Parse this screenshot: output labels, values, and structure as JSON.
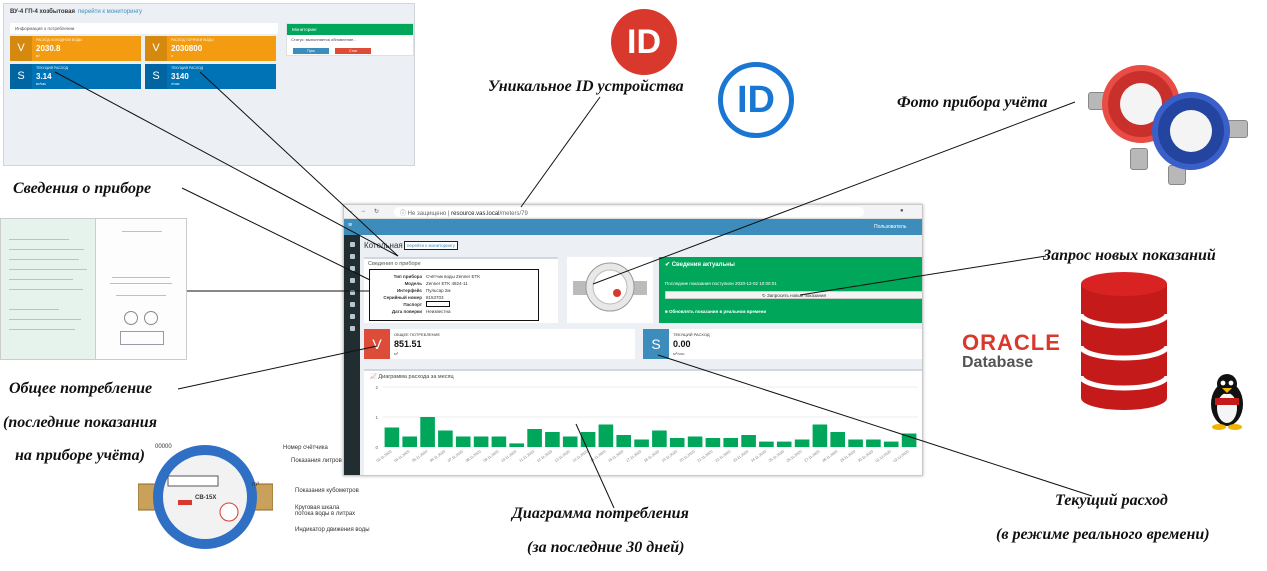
{
  "labels": {
    "unique_id": "Уникальное ID устройства",
    "photo": "Фото прибора учёта",
    "device_info": "Сведения о приборе",
    "request": "Запрос новых показаний",
    "total_line1": "Общее потребление",
    "total_line2": "(последние показания",
    "total_line3": "на приборе учёта)",
    "diagram_line1": "Диаграмма потребления",
    "diagram_line2": "(за последние 30 дней)",
    "current_line1": "Текущий расход",
    "current_line2": "(в режиме реального времени)"
  },
  "logos": {
    "id_text": "ID",
    "oracle": "ORACLE",
    "oracle_sub": "Database"
  },
  "mini": {
    "title": "ВУ-4 ГП-4 хозбытовая",
    "link": "перейти к мониторингу",
    "info_header": "Информация о потреблении",
    "status_header": "Мониторинг",
    "status_text": "Статус: выполняется обновление...",
    "btn_start": "Пуск",
    "btn_stop": "Стоп",
    "box1_label": "РАСХОД ХОЛОДНОЙ ВОДЫ",
    "box1_value": "2030.8",
    "box1_unit": "м³",
    "box2_label": "РАСХОД ГОРЯЧЕЙ ВОДЫ",
    "box2_value": "2030800",
    "box2_unit": "л",
    "box3_label": "ТЕКУЩИЙ РАСХОД",
    "box3_value": "3.14",
    "box3_unit": "м³/час",
    "box4_label": "ТЕКУЩИЙ РАСХОД",
    "box4_value": "3140",
    "box4_unit": "л/час"
  },
  "browser": {
    "not_secure": "Не защищено",
    "url_host": "resource.vas.local",
    "url_path": "/meters/79",
    "user": "Пользователь",
    "page_title": "Котельная",
    "crumb": "перейти к мониторингу",
    "info_panel_title": "Сведения о приборе",
    "fields": [
      {
        "k": "Тип прибора",
        "v": "Счётчик воды Zenner ETK"
      },
      {
        "k": "Модель",
        "v": "Zenner ETK 4824-11"
      },
      {
        "k": "Интерфейс",
        "v": "Пульсар 2м"
      },
      {
        "k": "Серийный номер",
        "v": "8153703"
      },
      {
        "k": "Паспорт",
        "v": ""
      },
      {
        "k": "Дата поверки",
        "v": "Неизвестна"
      }
    ],
    "status_title": "Сведения актуальны",
    "last_reading": "Последние показания поступили 2020-12-02 10:00:01",
    "request_btn": "Запросить новые показания",
    "realtime_check": "Обновлять показания в реальном времени",
    "total_label": "ОБЩЕЕ ПОТРЕБЛЕНИЕ",
    "total_value": "851.51",
    "total_unit": "м³",
    "total_icon": "V",
    "current_label": "ТЕКУЩИЙ РАСХОД",
    "current_value": "0.00",
    "current_unit": "м³/час",
    "current_icon": "S",
    "chart_title": "Диаграмма расхода за месяц"
  },
  "meter_annotations": [
    "Номер счётчика",
    "Показания литров",
    "Показания кубометров",
    "Круговая шкала потока воды в литрах",
    "Индикатор движения воды"
  ],
  "meter_face": {
    "brand": "СВ-15Х",
    "digits": "00000",
    "unit": "m³"
  },
  "colors": {
    "accent": "#3c8dbc",
    "green": "#00a65a",
    "orange": "#f39c12",
    "blue": "#0073b7",
    "red": "#dd4b39",
    "bar": "#00a65a"
  },
  "chart_data": {
    "type": "bar",
    "categories": [
      "03.11.2020",
      "04.11.2020",
      "05.11.2020",
      "06.11.2020",
      "07.11.2020",
      "08.11.2020",
      "09.11.2020",
      "10.11.2020",
      "11.11.2020",
      "12.11.2020",
      "13.11.2020",
      "14.11.2020",
      "15.11.2020",
      "16.11.2020",
      "17.11.2020",
      "18.11.2020",
      "19.11.2020",
      "20.11.2020",
      "21.11.2020",
      "22.11.2020",
      "23.11.2020",
      "24.11.2020",
      "25.11.2020",
      "26.11.2020",
      "27.11.2020",
      "28.11.2020",
      "29.11.2020",
      "30.11.2020",
      "01.12.2020",
      "02.12.2020"
    ],
    "values": [
      0.65,
      0.35,
      1.0,
      0.55,
      0.35,
      0.35,
      0.35,
      0.12,
      0.6,
      0.5,
      0.35,
      0.5,
      0.75,
      0.4,
      0.25,
      0.55,
      0.3,
      0.35,
      0.3,
      0.3,
      0.4,
      0.18,
      0.18,
      0.25,
      0.75,
      0.5,
      0.25,
      0.25,
      0.18,
      0.45
    ],
    "ylim": [
      0,
      2
    ],
    "yticks": [
      "0",
      "1",
      "2"
    ],
    "grid": true
  }
}
